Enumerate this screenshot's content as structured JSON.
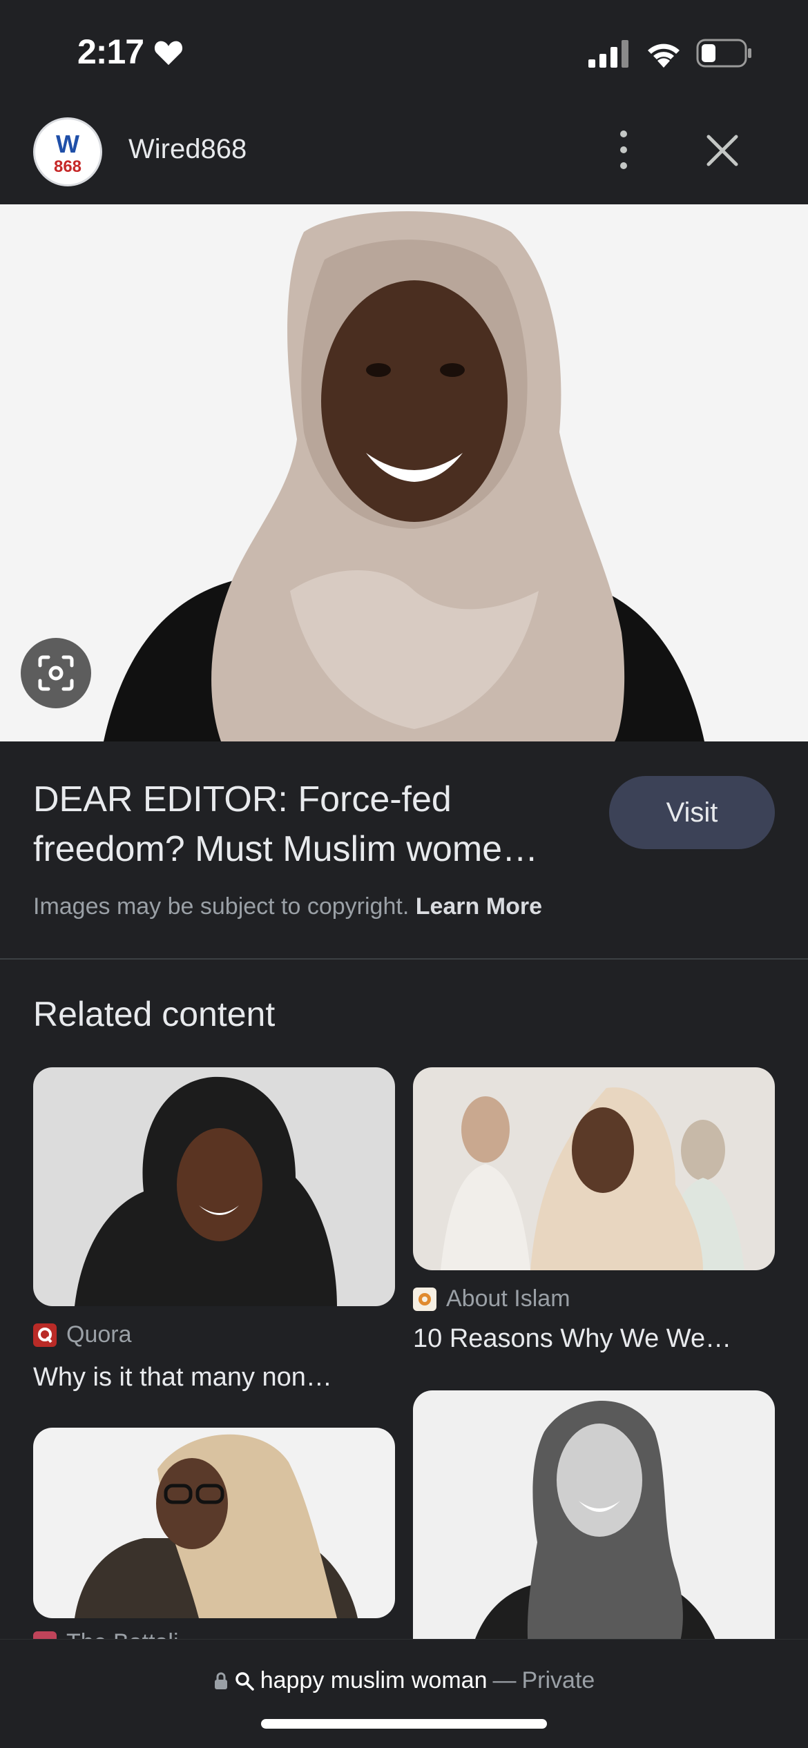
{
  "status_bar": {
    "time": "2:17"
  },
  "header": {
    "site_name": "Wired868",
    "avatar_text_top": "W",
    "avatar_text_bottom": "868"
  },
  "result": {
    "title_line1": "DEAR EDITOR: Force-fed",
    "title_line2": "freedom? Must Muslim wome…",
    "visit_label": "Visit",
    "copyright_text": "Images may be subject to copyright.",
    "learn_more_label": "Learn More"
  },
  "related": {
    "heading": "Related content",
    "items": [
      {
        "source": "Quora",
        "title": "Why is it that many non…",
        "icon": "quora-icon"
      },
      {
        "source": "About Islam",
        "title": "10 Reasons Why We We…",
        "icon": "about-islam-icon"
      },
      {
        "source": "The Battali…",
        "title": "",
        "icon": "site-icon"
      },
      {
        "source": "",
        "title": "",
        "icon": ""
      }
    ]
  },
  "bottom_bar": {
    "query": "happy muslim woman",
    "separator": "—",
    "mode": "Private"
  },
  "colors": {
    "background": "#202124",
    "visit_button": "#3c4257",
    "text": "#e8eaed",
    "muted": "#9aa0a6"
  }
}
